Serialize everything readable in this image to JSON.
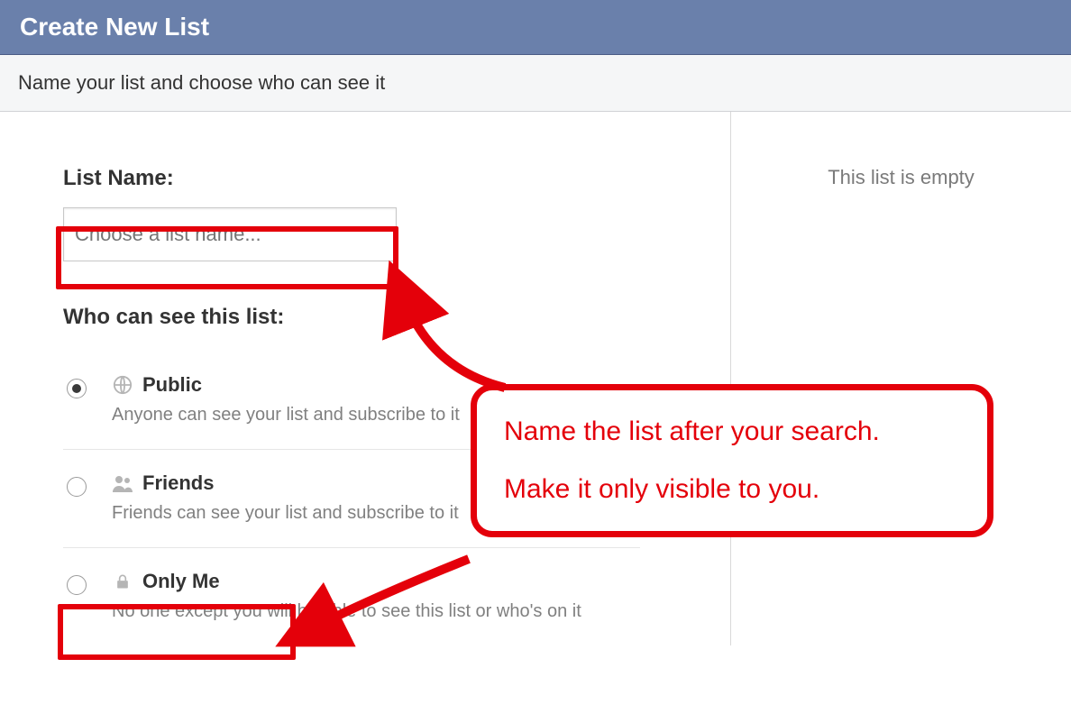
{
  "header": {
    "title": "Create New List"
  },
  "subheader": {
    "text": "Name your list and choose who can see it"
  },
  "form": {
    "listNameLabel": "List Name:",
    "listNamePlaceholder": "Choose a list name...",
    "visibilityLabel": "Who can see this list:"
  },
  "options": {
    "public": {
      "name": "Public",
      "desc": "Anyone can see your list and subscribe to it"
    },
    "friends": {
      "name": "Friends",
      "desc": "Friends can see your list and subscribe to it"
    },
    "onlyme": {
      "name": "Only Me",
      "desc": "No one except you will be able to see this list or who's on it"
    }
  },
  "sidebar": {
    "emptyText": "This list is empty"
  },
  "annotation": {
    "line1": "Name the list after your search.",
    "line2": "Make it only visible to you."
  }
}
